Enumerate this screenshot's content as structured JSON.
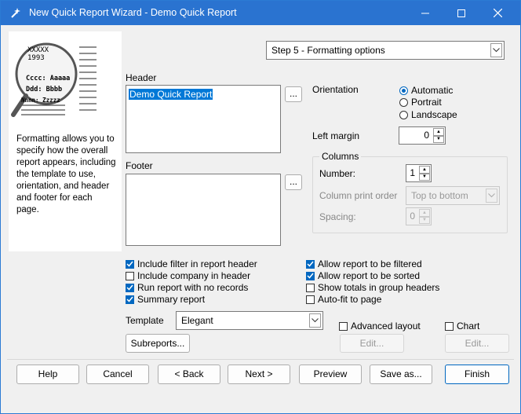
{
  "window": {
    "title": "New Quick Report Wizard - Demo Quick Report"
  },
  "illustration": {
    "lines": [
      "XXXXX",
      "1993",
      "Cccc: Aaaaa",
      "Ddd: Bbbb",
      "Nnnn: Zzzzz"
    ]
  },
  "help_text": "Formatting allows you to specify how the overall report appears, including the template to use, orientation, and header and footer for each page.",
  "step_select": {
    "value": "Step 5 - Formatting options"
  },
  "header": {
    "label": "Header",
    "value": "Demo Quick Report",
    "ellipsis": "..."
  },
  "footer": {
    "label": "Footer",
    "value": "",
    "ellipsis": "..."
  },
  "orientation": {
    "label": "Orientation",
    "options": [
      "Automatic",
      "Portrait",
      "Landscape"
    ],
    "selected": "Automatic"
  },
  "left_margin": {
    "label": "Left margin",
    "value": "0"
  },
  "columns": {
    "group_label": "Columns",
    "number_label": "Number:",
    "number_value": "1",
    "print_order_label": "Column print order",
    "print_order_value": "Top to bottom",
    "spacing_label": "Spacing:",
    "spacing_value": "0"
  },
  "checkboxes_left": [
    {
      "label": "Include filter in report header",
      "checked": true
    },
    {
      "label": "Include company in header",
      "checked": false
    },
    {
      "label": "Run report with no records",
      "checked": true
    },
    {
      "label": "Summary report",
      "checked": true
    }
  ],
  "checkboxes_right": [
    {
      "label": "Allow report to be filtered",
      "checked": true
    },
    {
      "label": "Allow report to be sorted",
      "checked": true
    },
    {
      "label": "Show totals in group headers",
      "checked": false
    },
    {
      "label": "Auto-fit to page",
      "checked": false
    }
  ],
  "template": {
    "label": "Template",
    "value": "Elegant"
  },
  "subreports_button": "Subreports...",
  "advanced_layout": {
    "label": "Advanced layout",
    "checked": false,
    "edit": "Edit..."
  },
  "chart": {
    "label": "Chart",
    "checked": false,
    "edit": "Edit..."
  },
  "footer_buttons": {
    "help": "Help",
    "cancel": "Cancel",
    "back": "< Back",
    "next": "Next >",
    "preview": "Preview",
    "save_as": "Save as...",
    "finish": "Finish"
  }
}
